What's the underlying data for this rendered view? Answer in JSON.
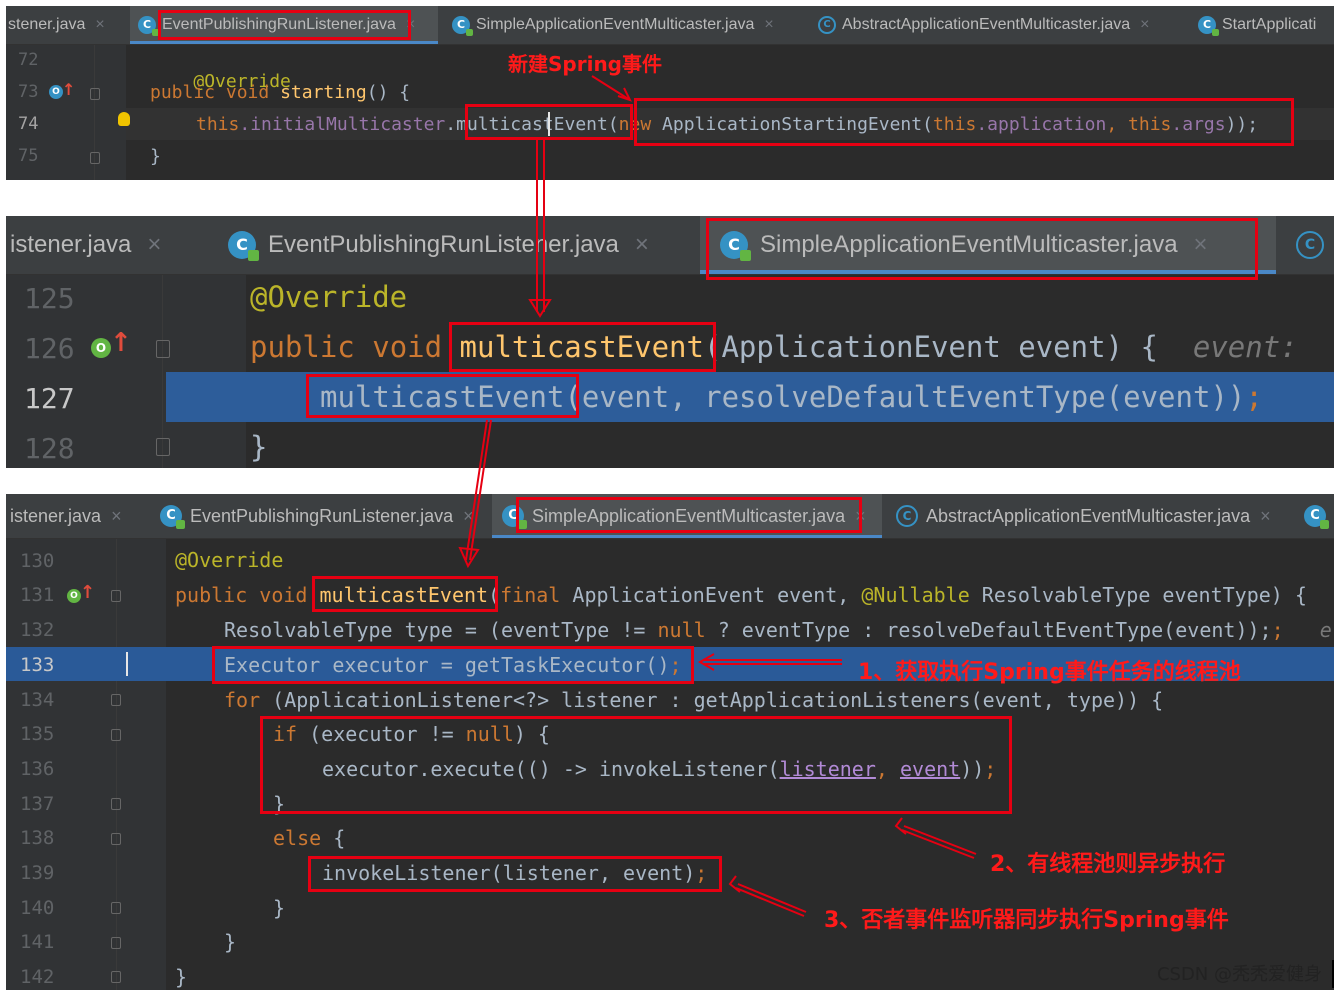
{
  "panel1": {
    "tabs": [
      {
        "label": "stener.java"
      },
      {
        "label": "EventPublishingRunListener.java"
      },
      {
        "label": "SimpleApplicationEventMulticaster.java"
      },
      {
        "label": "AbstractApplicationEventMulticaster.java"
      },
      {
        "label": "StartApplicati"
      }
    ],
    "lines": {
      "l72": "72",
      "l73": "73",
      "l74": "74",
      "l75": "75"
    },
    "code": {
      "annotation": "@Override",
      "kw_public": "public",
      "kw_void": "void",
      "method": "starting",
      "sig_tail": "() {",
      "this1": "this",
      "field_initial": ".initialMulticaster",
      "dot": ".",
      "call": "multicastEvent",
      "paren": "(",
      "kw_new": "new",
      "ctor": " ApplicationStartingEvent(",
      "this2": "this",
      "field_application": ".application",
      "comma": ", ",
      "this3": "this",
      "field_args": ".args",
      "tail": "));",
      "close": "}"
    },
    "note": "新建Spring事件"
  },
  "panel2": {
    "tabs": [
      {
        "label": "istener.java"
      },
      {
        "label": "EventPublishingRunListener.java"
      },
      {
        "label": "SimpleApplicationEventMulticaster.java"
      }
    ],
    "lines": {
      "l125": "125",
      "l126": "126",
      "l127": "127",
      "l128": "128"
    },
    "code": {
      "annotation": "@Override",
      "kw_public": "public",
      "kw_void": "void",
      "method": "multicastEvent",
      "params": "(ApplicationEvent event) {",
      "hint": "event:",
      "call": "multicastEvent",
      "args": "(event, resolveDefaultEventType(event))",
      "semi": ";",
      "close": "}"
    }
  },
  "panel3": {
    "tabs": [
      {
        "label": "istener.java"
      },
      {
        "label": "EventPublishingRunListener.java"
      },
      {
        "label": "SimpleApplicationEventMulticaster.java"
      },
      {
        "label": "AbstractApplicationEventMulticaster.java"
      }
    ],
    "lines": {
      "l130": "130",
      "l131": "131",
      "l132": "132",
      "l133": "133",
      "l134": "134",
      "l135": "135",
      "l136": "136",
      "l137": "137",
      "l138": "138",
      "l139": "139",
      "l140": "140",
      "l141": "141",
      "l142": "142"
    },
    "code": {
      "annotation": "@Override",
      "kw_public": "public",
      "kw_void": "void",
      "method": "multicastEvent",
      "paren": "(",
      "kw_final": "final",
      "param1": " ApplicationEvent event, ",
      "nullable": "@Nullable",
      "param2": " ResolvableType eventType) {",
      "l132_a": "ResolvableType type = (eventType != ",
      "kw_null": "null",
      "l132_b": " ? eventType : resolveDefaultEventType(event));",
      "l132_ghost": "e",
      "l133": "Executor executor = getTaskExecutor()",
      "semi": ";",
      "kw_for": "for",
      "l134": " (ApplicationListener<?> listener : getApplicationListeners(event, type)) {",
      "kw_if": "if",
      "l135_a": " (executor != ",
      "l135_b": ") {",
      "l136_a": "executor.execute(() -> invokeListener(",
      "u_listener": "listener",
      "comma": ", ",
      "u_event": "event",
      "l136_b": "))",
      "close_brace": "}",
      "kw_else": "else",
      "else_tail": " {",
      "l139": "invokeListener(listener, event)"
    },
    "notes": {
      "n1": "1、获取执行Spring事件任务的线程池",
      "n2": "2、有线程池则异步执行",
      "n3": "3、否者事件监听器同步执行Spring事件"
    }
  },
  "credit": "CSDN @秃秃爱健身",
  "colors": {
    "annotation_red": "#e60012",
    "tab_underline": "#4a88c7",
    "selection": "#2d5d9a"
  }
}
